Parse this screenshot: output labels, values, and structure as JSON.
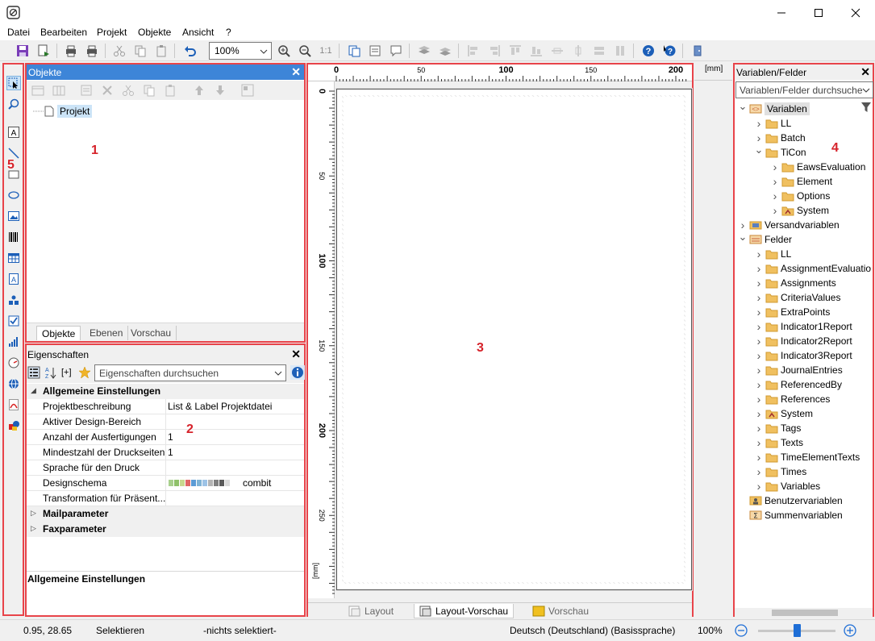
{
  "menu": [
    "Datei",
    "Bearbeiten",
    "Projekt",
    "Objekte",
    "Ansicht",
    "?"
  ],
  "toolbar": {
    "zoom_value": "100%",
    "zoom_reset_label": "1:1"
  },
  "objekte_panel": {
    "title": "Objekte",
    "tree_root": "Projekt",
    "tabs": [
      "Objekte",
      "Ebenen",
      "Vorschau"
    ]
  },
  "eigenschaften_panel": {
    "title": "Eigenschaften",
    "sort_label": "[+]",
    "search_placeholder": "Eigenschaften durchsuchen",
    "group_main": "Allgemeine Einstellungen",
    "rows": [
      {
        "key": "Projektbeschreibung",
        "value": "List & Label Projektdatei"
      },
      {
        "key": "Aktiver Design-Bereich",
        "value": ""
      },
      {
        "key": "Anzahl der Ausfertigungen",
        "value": "1"
      },
      {
        "key": "Mindestzahl der Druckseiten",
        "value": "1"
      },
      {
        "key": "Sprache für den Druck",
        "value": ""
      },
      {
        "key": "Designschema",
        "value": "combit"
      },
      {
        "key": "Transformation für Präsent...",
        "value": ""
      }
    ],
    "groups_collapsed": [
      "Mailparameter",
      "Faxparameter"
    ],
    "description_title": "Allgemeine Einstellungen",
    "scheme_colors": [
      "#a8d08d",
      "#8fc16a",
      "#c8d98f",
      "#e06666",
      "#5b9bd5",
      "#7fb3d5",
      "#9dc3e6",
      "#b4b4b4",
      "#7f7f7f",
      "#595959",
      "#d9d9d9"
    ]
  },
  "design": {
    "ruler_top": [
      "0",
      "50",
      "100",
      "150",
      "200"
    ],
    "ruler_left": [
      "0",
      "50",
      "100",
      "150",
      "200",
      "250"
    ],
    "ruler_unit": "[mm]",
    "tabs": [
      "Layout",
      "Layout-Vorschau",
      "Vorschau"
    ]
  },
  "mm_label": "[mm]",
  "variables_panel": {
    "title": "Variablen/Felder",
    "search_placeholder": "Variablen/Felder durchsuchen",
    "tree": [
      {
        "label": "Variablen",
        "level": 0,
        "exp": "open",
        "icon": "variables-icon",
        "selected": true
      },
      {
        "label": "LL",
        "level": 1,
        "exp": "closed",
        "icon": "folder-icon"
      },
      {
        "label": "Batch",
        "level": 1,
        "exp": "closed",
        "icon": "folder-icon"
      },
      {
        "label": "TiCon",
        "level": 1,
        "exp": "open",
        "icon": "folder-icon"
      },
      {
        "label": "EawsEvaluation",
        "level": 2,
        "exp": "closed",
        "icon": "folder-icon"
      },
      {
        "label": "Element",
        "level": 2,
        "exp": "closed",
        "icon": "folder-icon"
      },
      {
        "label": "Options",
        "level": 2,
        "exp": "closed",
        "icon": "folder-icon"
      },
      {
        "label": "System",
        "level": 2,
        "exp": "closed",
        "icon": "system-folder-icon"
      },
      {
        "label": "Versandvariablen",
        "level": 0,
        "exp": "closed",
        "icon": "shipping-icon"
      },
      {
        "label": "Felder",
        "level": 0,
        "exp": "open",
        "icon": "fields-icon"
      },
      {
        "label": "LL",
        "level": 1,
        "exp": "closed",
        "icon": "folder-icon"
      },
      {
        "label": "AssignmentEvaluatio",
        "level": 1,
        "exp": "closed",
        "icon": "folder-icon"
      },
      {
        "label": "Assignments",
        "level": 1,
        "exp": "closed",
        "icon": "folder-icon"
      },
      {
        "label": "CriteriaValues",
        "level": 1,
        "exp": "closed",
        "icon": "folder-icon"
      },
      {
        "label": "ExtraPoints",
        "level": 1,
        "exp": "closed",
        "icon": "folder-icon"
      },
      {
        "label": "Indicator1Report",
        "level": 1,
        "exp": "closed",
        "icon": "folder-icon"
      },
      {
        "label": "Indicator2Report",
        "level": 1,
        "exp": "closed",
        "icon": "folder-icon"
      },
      {
        "label": "Indicator3Report",
        "level": 1,
        "exp": "closed",
        "icon": "folder-icon"
      },
      {
        "label": "JournalEntries",
        "level": 1,
        "exp": "closed",
        "icon": "folder-icon"
      },
      {
        "label": "ReferencedBy",
        "level": 1,
        "exp": "closed",
        "icon": "folder-icon"
      },
      {
        "label": "References",
        "level": 1,
        "exp": "closed",
        "icon": "folder-icon"
      },
      {
        "label": "System",
        "level": 1,
        "exp": "closed",
        "icon": "system-folder-icon"
      },
      {
        "label": "Tags",
        "level": 1,
        "exp": "closed",
        "icon": "folder-icon"
      },
      {
        "label": "Texts",
        "level": 1,
        "exp": "closed",
        "icon": "folder-icon"
      },
      {
        "label": "TimeElementTexts",
        "level": 1,
        "exp": "closed",
        "icon": "folder-icon"
      },
      {
        "label": "Times",
        "level": 1,
        "exp": "closed",
        "icon": "folder-icon"
      },
      {
        "label": "Variables",
        "level": 1,
        "exp": "closed",
        "icon": "folder-icon"
      },
      {
        "label": "Benutzervariablen",
        "level": 0,
        "exp": "none",
        "icon": "user-variables-icon"
      },
      {
        "label": "Summenvariablen",
        "level": 0,
        "exp": "none",
        "icon": "sum-variables-icon"
      }
    ]
  },
  "statusbar": {
    "coords": "0.95, 28.65",
    "mode": "Selektieren",
    "selection": "-nichts selektiert-",
    "language": "Deutsch (Deutschland) (Basissprache)",
    "zoom": "100%",
    "zoom_level": 0.5
  },
  "callouts": [
    "1",
    "2",
    "3",
    "4",
    "5"
  ],
  "colors": {
    "callout_red": "#e8444a",
    "panel_header_blue": "#3d85d8",
    "selection_blue": "#cce4f7"
  }
}
